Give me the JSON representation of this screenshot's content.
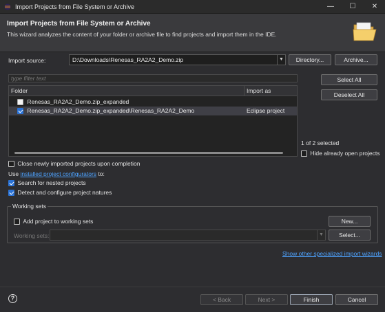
{
  "window": {
    "title": "Import Projects from File System or Archive",
    "controls": {
      "minimize": "—",
      "maximize": "☐",
      "close": "✕"
    }
  },
  "header": {
    "title": "Import Projects from File System or Archive",
    "description": "This wizard analyzes the content of your folder or archive file to find projects and import them in the IDE."
  },
  "import_source": {
    "label": "Import source:",
    "value": "D:\\Downloads\\Renesas_RA2A2_Demo.zip",
    "directory_button": "Directory...",
    "archive_button": "Archive..."
  },
  "filter": {
    "placeholder": "type filter text"
  },
  "table": {
    "columns": [
      "Folder",
      "Import as"
    ],
    "rows": [
      {
        "folder": "Renesas_RA2A2_Demo.zip_expanded",
        "import_as": "",
        "checked": false
      },
      {
        "folder": "Renesas_RA2A2_Demo.zip_expanded\\Renesas_RA2A2_Demo",
        "import_as": "Eclipse project",
        "checked": true
      }
    ]
  },
  "side": {
    "select_all": "Select All",
    "deselect_all": "Deselect All",
    "selected_count": "1 of 2 selected",
    "hide_open": "Hide already open projects"
  },
  "options": {
    "close_imported": "Close newly imported projects upon completion",
    "use_prefix": "Use",
    "configurators_link": "installed project configurators",
    "use_suffix": "to:",
    "search_nested": "Search for nested projects",
    "detect_natures": "Detect and configure project natures"
  },
  "working_sets": {
    "title": "Working sets",
    "add_label": "Add project to working sets",
    "new_button": "New...",
    "sets_label": "Working sets:",
    "select_button": "Select..."
  },
  "other_wizards_link": "Show other specialized import wizards",
  "footer": {
    "help": "?",
    "back": "< Back",
    "next": "Next >",
    "finish": "Finish",
    "cancel": "Cancel"
  }
}
